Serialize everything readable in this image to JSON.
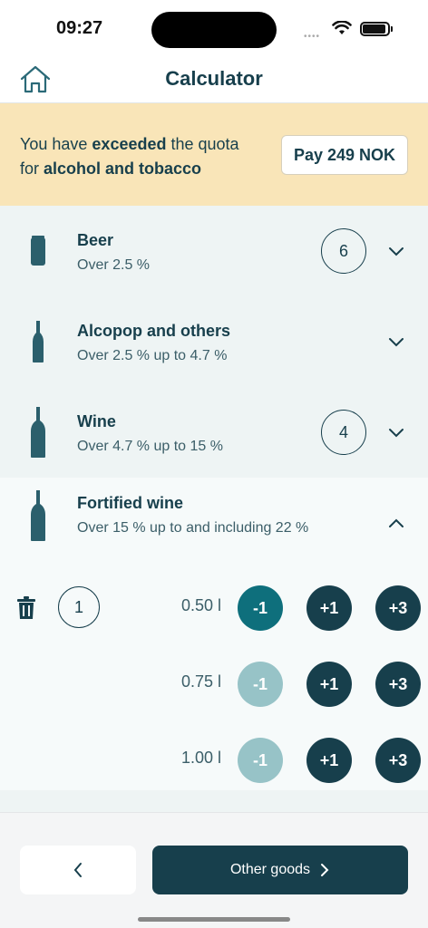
{
  "status_bar": {
    "time": "09:27"
  },
  "nav": {
    "title": "Calculator"
  },
  "banner": {
    "prefix": "You have ",
    "emph1": "exceeded",
    "middle": " the quota",
    "line2_prefix": "for ",
    "emph2": "alcohol and tobacco",
    "pay_label": "Pay 249 NOK"
  },
  "items": [
    {
      "name": "Beer",
      "desc": "Over 2.5 %",
      "count": "6",
      "icon": "can-icon"
    },
    {
      "name": "Alcopop and others",
      "desc": "Over 2.5 % up to 4.7 %",
      "count": "",
      "icon": "bottle-icon"
    },
    {
      "name": "Wine",
      "desc": "Over 4.7 % up to 15 %",
      "count": "4",
      "icon": "wine-bottle-icon"
    },
    {
      "name": "Fortified wine",
      "desc": "Over 15 % up to and including 22 %",
      "count": "",
      "icon": "wine-bottle-icon"
    }
  ],
  "fortified_rows": [
    {
      "volume": "0.50 l",
      "count": "1",
      "minus": "-1",
      "plus1": "+1",
      "plus3": "+3"
    },
    {
      "volume": "0.75 l",
      "count": "",
      "minus": "-1",
      "plus1": "+1",
      "plus3": "+3"
    },
    {
      "volume": "1.00 l",
      "count": "",
      "minus": "-1",
      "plus1": "+1",
      "plus3": "+3"
    }
  ],
  "footer": {
    "next_label": "Other goods"
  },
  "colors": {
    "primary": "#173f4c",
    "accent": "#0e6f7c",
    "banner": "#f9e5b8"
  }
}
